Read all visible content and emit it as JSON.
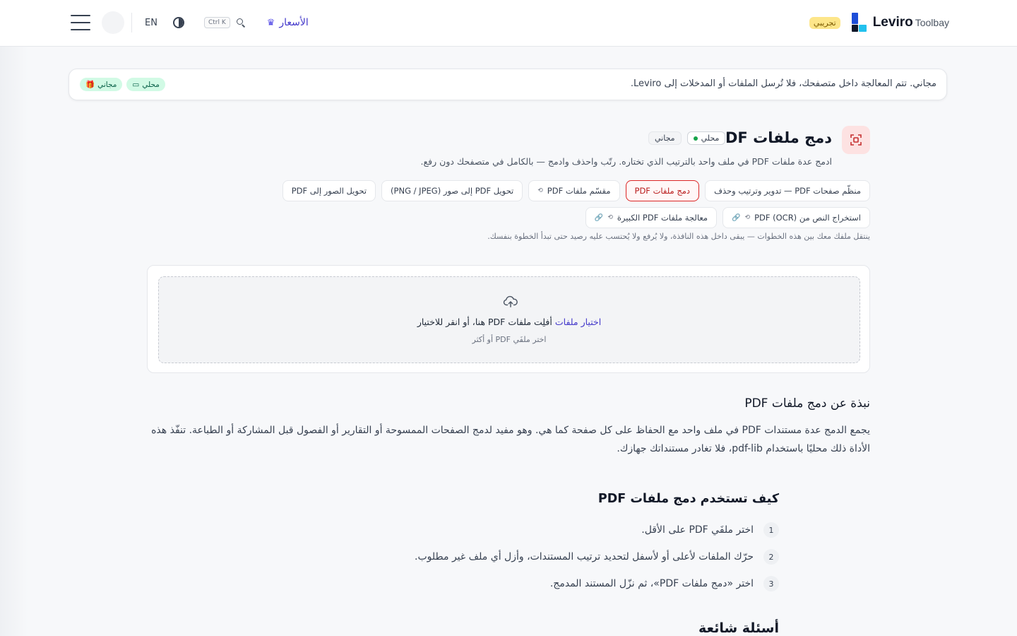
{
  "header": {
    "brand_name": "Leviro",
    "brand_suffix": "Toolbay",
    "trial_badge": "تجريبي",
    "pricing_label": "الأسعار",
    "search_shortcut": "Ctrl K",
    "language": "EN",
    "icons": [
      "menu-icon",
      "contrast-icon",
      "search-icon",
      "crown-icon"
    ]
  },
  "notice": {
    "text": "مجاني. تتم المعالجة داخل متصفحك، فلا تُرسل الملفات أو المدخلات إلى Leviro.",
    "badge_local": "محلي",
    "badge_free": "مجاني"
  },
  "tool": {
    "title": "دمج ملفات PDF",
    "badge_local": "محلي",
    "badge_free": "مجاني",
    "subtitle": "ادمج عدة ملفات PDF في ملف واحد بالترتيب الذي تختاره. رتّب واحذف وادمج — بالكامل في متصفحك دون رفع.",
    "accent_color": "#dc2626"
  },
  "chips": [
    {
      "label": "منظّم صفحات PDF — تدوير وترتيب وحذف",
      "active": false,
      "extra": "",
      "link": false
    },
    {
      "label": "دمج ملفات PDF",
      "active": true,
      "extra": "",
      "link": false
    },
    {
      "label": "مقسّم ملفات PDF",
      "active": false,
      "extra": "⟲",
      "link": false
    },
    {
      "label": "تحويل PDF إلى صور (PNG / JPEG)",
      "active": false,
      "extra": "",
      "link": false
    },
    {
      "label": "تحويل الصور إلى PDF",
      "active": false,
      "extra": "",
      "link": false
    },
    {
      "label": "استخراج النص من PDF (OCR)",
      "active": false,
      "extra": "⟲",
      "link": true
    },
    {
      "label": "معالجة ملفات PDF الكبيرة",
      "active": false,
      "extra": "⟲",
      "link": true
    }
  ],
  "chips_note": "ينتقل ملفك معك بين هذه الخطوات — يبقى داخل هذه النافذة، ولا يُرفع ولا يُحتسب عليه رصيد حتى تبدأ الخطوة بنفسك.",
  "dropzone": {
    "choose": "اختيار ملفات",
    "line1": "أفلِت ملفات PDF هنا، أو انقر للاختيار",
    "line2": "اختر ملفَي PDF أو أكثر"
  },
  "about": {
    "heading": "نبذة عن دمج ملفات PDF",
    "text": "يجمع الدمج عدة مستندات PDF في ملف واحد مع الحفاظ على كل صفحة كما هي. وهو مفيد لدمج الصفحات الممسوحة أو التقارير أو الفصول قبل المشاركة أو الطباعة. تنفّذ هذه الأداة ذلك محليًا باستخدام pdf-lib، فلا تغادر مستنداتك جهازك."
  },
  "howto": {
    "heading": "كيف تستخدم دمج ملفات PDF",
    "steps": [
      {
        "num": "1",
        "text": "اختر ملفَي PDF على الأقل."
      },
      {
        "num": "2",
        "text": "حرّك الملفات لأعلى أو لأسفل لتحديد ترتيب المستندات، وأزل أي ملف غير مطلوب."
      },
      {
        "num": "3",
        "text": "اختر «دمج ملفات PDF»، ثم نزّل المستند المدمج."
      }
    ]
  },
  "faq": {
    "heading": "أسئلة شائعة"
  }
}
